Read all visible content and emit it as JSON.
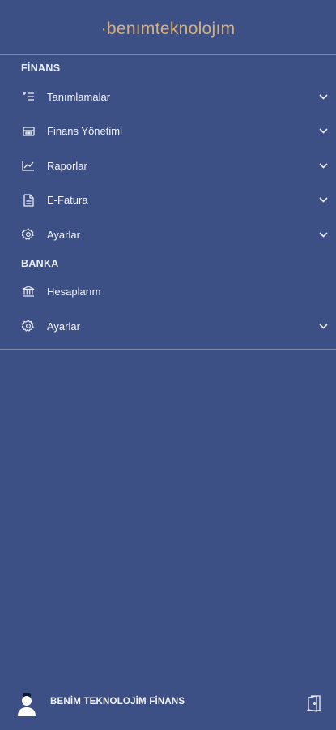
{
  "brand": {
    "logo_text": "·benımteknolojım"
  },
  "colors": {
    "background": "#3d5085",
    "brand_accent": "#d8b07a",
    "text": "#f2f4fa"
  },
  "sections": [
    {
      "title": "FİNANS",
      "items": [
        {
          "label": "Tanımlamalar",
          "icon": "list-add-icon",
          "expandable": true
        },
        {
          "label": "Finans Yönetimi",
          "icon": "wallet-icon",
          "expandable": true
        },
        {
          "label": "Raporlar",
          "icon": "chart-line-icon",
          "expandable": true
        },
        {
          "label": "E-Fatura",
          "icon": "invoice-icon",
          "expandable": true
        },
        {
          "label": "Ayarlar",
          "icon": "gear-icon",
          "expandable": true
        }
      ]
    },
    {
      "title": "BANKA",
      "items": [
        {
          "label": "Hesaplarım",
          "icon": "bank-icon",
          "expandable": false
        },
        {
          "label": "Ayarlar",
          "icon": "gear-icon",
          "expandable": true
        }
      ]
    }
  ],
  "footer": {
    "username": "BENİM TEKNOLOJİM FİNANS",
    "avatar_icon": "user-avatar-icon",
    "logout_icon": "logout-door-icon"
  }
}
